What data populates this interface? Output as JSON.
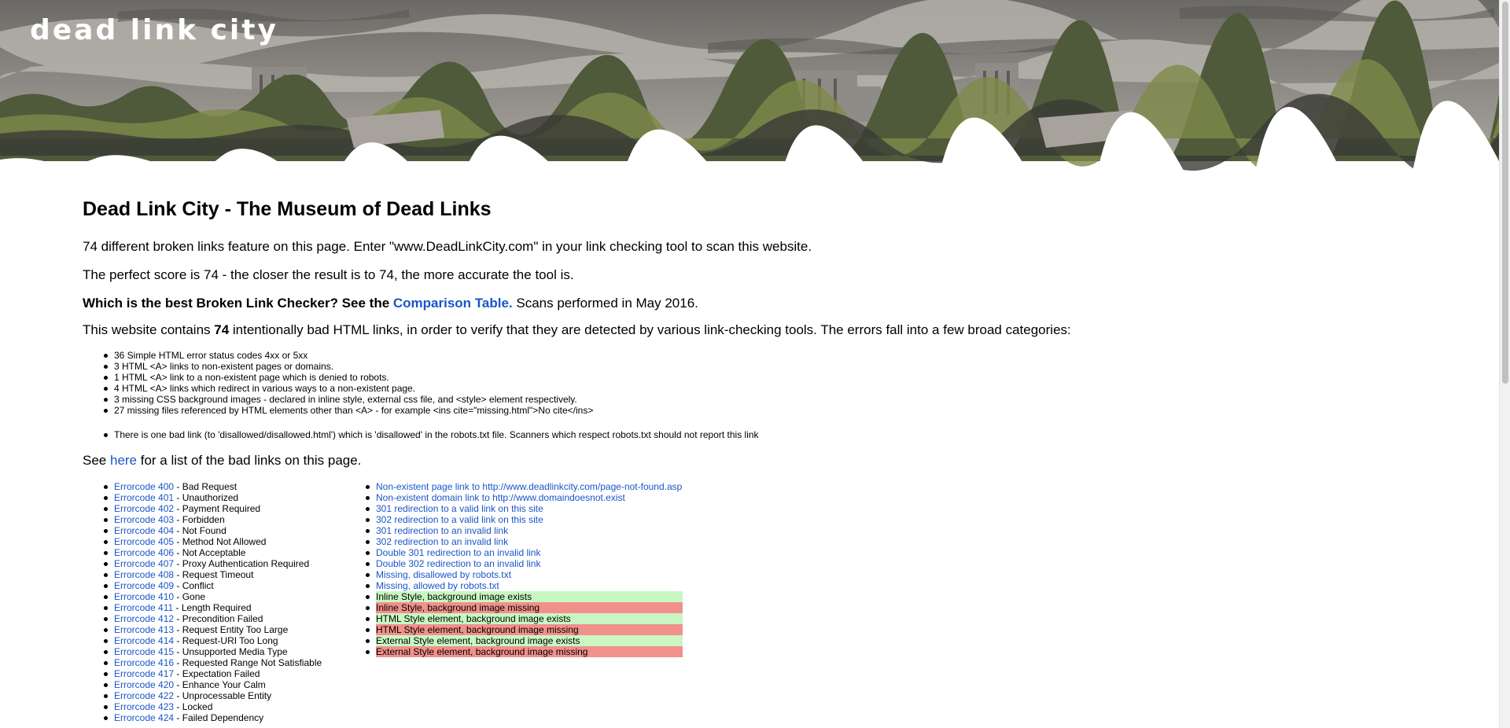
{
  "header": {
    "logo_text": "dead link city"
  },
  "main": {
    "title": "Dead Link City - The Museum of Dead Links",
    "intro1": "74 different broken links feature on this page. Enter \"www.DeadLinkCity.com\" in your link checking tool to scan this website.",
    "intro2": "The perfect score is 74 - the closer the result is to 74, the more accurate the tool is.",
    "best_q": "Which is the best Broken Link Checker? See the ",
    "comparison_link": "Comparison Table.",
    "scans": " Scans performed in May 2016.",
    "contains_pre": "This website contains ",
    "contains_num": "74",
    "contains_post": " intentionally bad HTML links, in order to verify that they are detected by various link-checking tools. The errors fall into a few broad categories:",
    "categories": [
      "36 Simple HTML error status codes 4xx or 5xx",
      "3 HTML <A> links to non-existent pages or domains.",
      "1 HTML <A> link to a non-existent page which is denied to robots.",
      "4 HTML <A> links which redirect in various ways to a non-existent page.",
      "3 missing CSS background images - declared in inline style, external css file, and <style> element respectively.",
      "27 missing files referenced by HTML elements other than <A> - for example <ins cite=\"missing.html\">No cite</ins>"
    ],
    "robots_note": "There is one bad link (to 'disallowed/disallowed.html') which is 'disallowed' in the robots.txt file. Scanners which respect robots.txt should not report this link",
    "see_pre": "See ",
    "see_link": "here",
    "see_post": " for a list of the bad links on this page."
  },
  "error_codes": [
    {
      "link": "Errorcode 400",
      "desc": " - Bad Request"
    },
    {
      "link": "Errorcode 401",
      "desc": " - Unauthorized"
    },
    {
      "link": "Errorcode 402",
      "desc": " - Payment Required"
    },
    {
      "link": "Errorcode 403",
      "desc": " - Forbidden"
    },
    {
      "link": "Errorcode 404",
      "desc": " - Not Found"
    },
    {
      "link": "Errorcode 405",
      "desc": " - Method Not Allowed"
    },
    {
      "link": "Errorcode 406",
      "desc": " - Not Acceptable"
    },
    {
      "link": "Errorcode 407",
      "desc": " - Proxy Authentication Required"
    },
    {
      "link": "Errorcode 408",
      "desc": " - Request Timeout"
    },
    {
      "link": "Errorcode 409",
      "desc": " - Conflict"
    },
    {
      "link": "Errorcode 410",
      "desc": " - Gone"
    },
    {
      "link": "Errorcode 411",
      "desc": " - Length Required"
    },
    {
      "link": "Errorcode 412",
      "desc": " - Precondition Failed"
    },
    {
      "link": "Errorcode 413",
      "desc": " - Request Entity Too Large"
    },
    {
      "link": "Errorcode 414",
      "desc": " - Request-URI Too Long"
    },
    {
      "link": "Errorcode 415",
      "desc": " - Unsupported Media Type"
    },
    {
      "link": "Errorcode 416",
      "desc": " - Requested Range Not Satisfiable"
    },
    {
      "link": "Errorcode 417",
      "desc": " - Expectation Failed"
    },
    {
      "link": "Errorcode 420",
      "desc": " - Enhance Your Calm"
    },
    {
      "link": "Errorcode 422",
      "desc": " - Unprocessable Entity"
    },
    {
      "link": "Errorcode 423",
      "desc": " - Locked"
    },
    {
      "link": "Errorcode 424",
      "desc": " - Failed Dependency"
    }
  ],
  "test_links": [
    {
      "text": "Non-existent page link to http://www.deadlinkcity.com/page-not-found.asp",
      "kind": "link"
    },
    {
      "text": "Non-existent domain link to http://www.domaindoesnot.exist",
      "kind": "link"
    },
    {
      "text": "301 redirection to a valid link on this site",
      "kind": "link"
    },
    {
      "text": "302 redirection to a valid link on this site",
      "kind": "link"
    },
    {
      "text": "301 redirection to an invalid link",
      "kind": "link"
    },
    {
      "text": "302 redirection to an invalid link",
      "kind": "link"
    },
    {
      "text": "Double 301 redirection to an invalid link",
      "kind": "link"
    },
    {
      "text": "Double 302 redirection to an invalid link",
      "kind": "link"
    },
    {
      "text": "Missing, disallowed by robots.txt",
      "kind": "link"
    },
    {
      "text": "Missing, allowed by robots.txt",
      "kind": "link"
    },
    {
      "text": "Inline Style, background image exists",
      "kind": "ok"
    },
    {
      "text": "Inline Style, background image missing",
      "kind": "bad"
    },
    {
      "text": "HTML Style element, background image exists",
      "kind": "ok"
    },
    {
      "text": "HTML Style element, background image missing",
      "kind": "bad"
    },
    {
      "text": "External Style element, background image exists",
      "kind": "ok"
    },
    {
      "text": "External Style element, background image missing",
      "kind": "bad"
    }
  ],
  "colors": {
    "link": "#1a55c9",
    "ok_bg": "#c9f7c3",
    "bad_bg": "#f2908c"
  }
}
